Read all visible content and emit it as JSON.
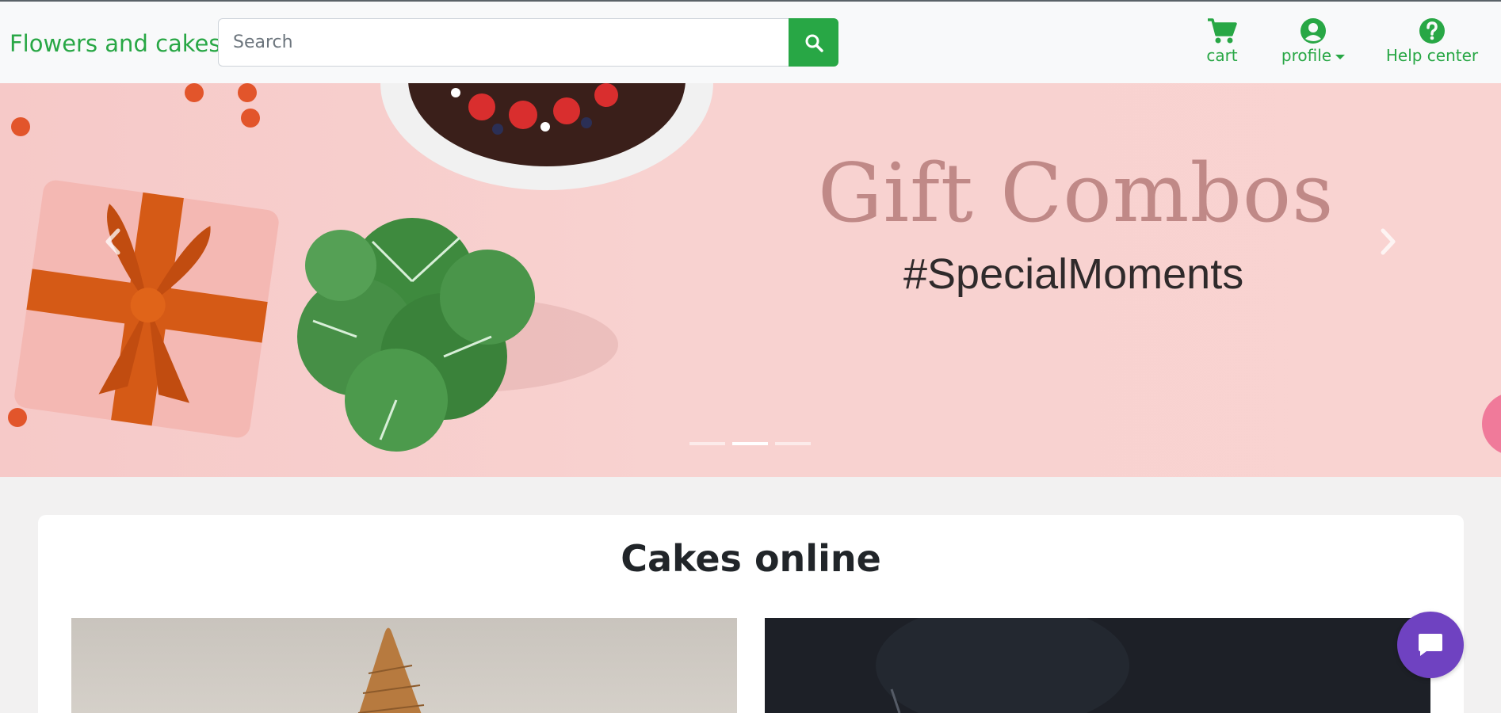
{
  "navbar": {
    "brand": "Flowers and cakes",
    "search_placeholder": "Search",
    "cart_label": "cart",
    "profile_label": "profile",
    "help_label": "Help center"
  },
  "hero": {
    "title": "Gift Combos",
    "subtitle": "#SpecialMoments",
    "active_slide": 2,
    "slide_count": 3
  },
  "section": {
    "title": "Cakes online"
  },
  "colors": {
    "brand_green": "#28a745",
    "chat_purple": "#6f42c1",
    "hero_pink": "#f8d2d0"
  }
}
